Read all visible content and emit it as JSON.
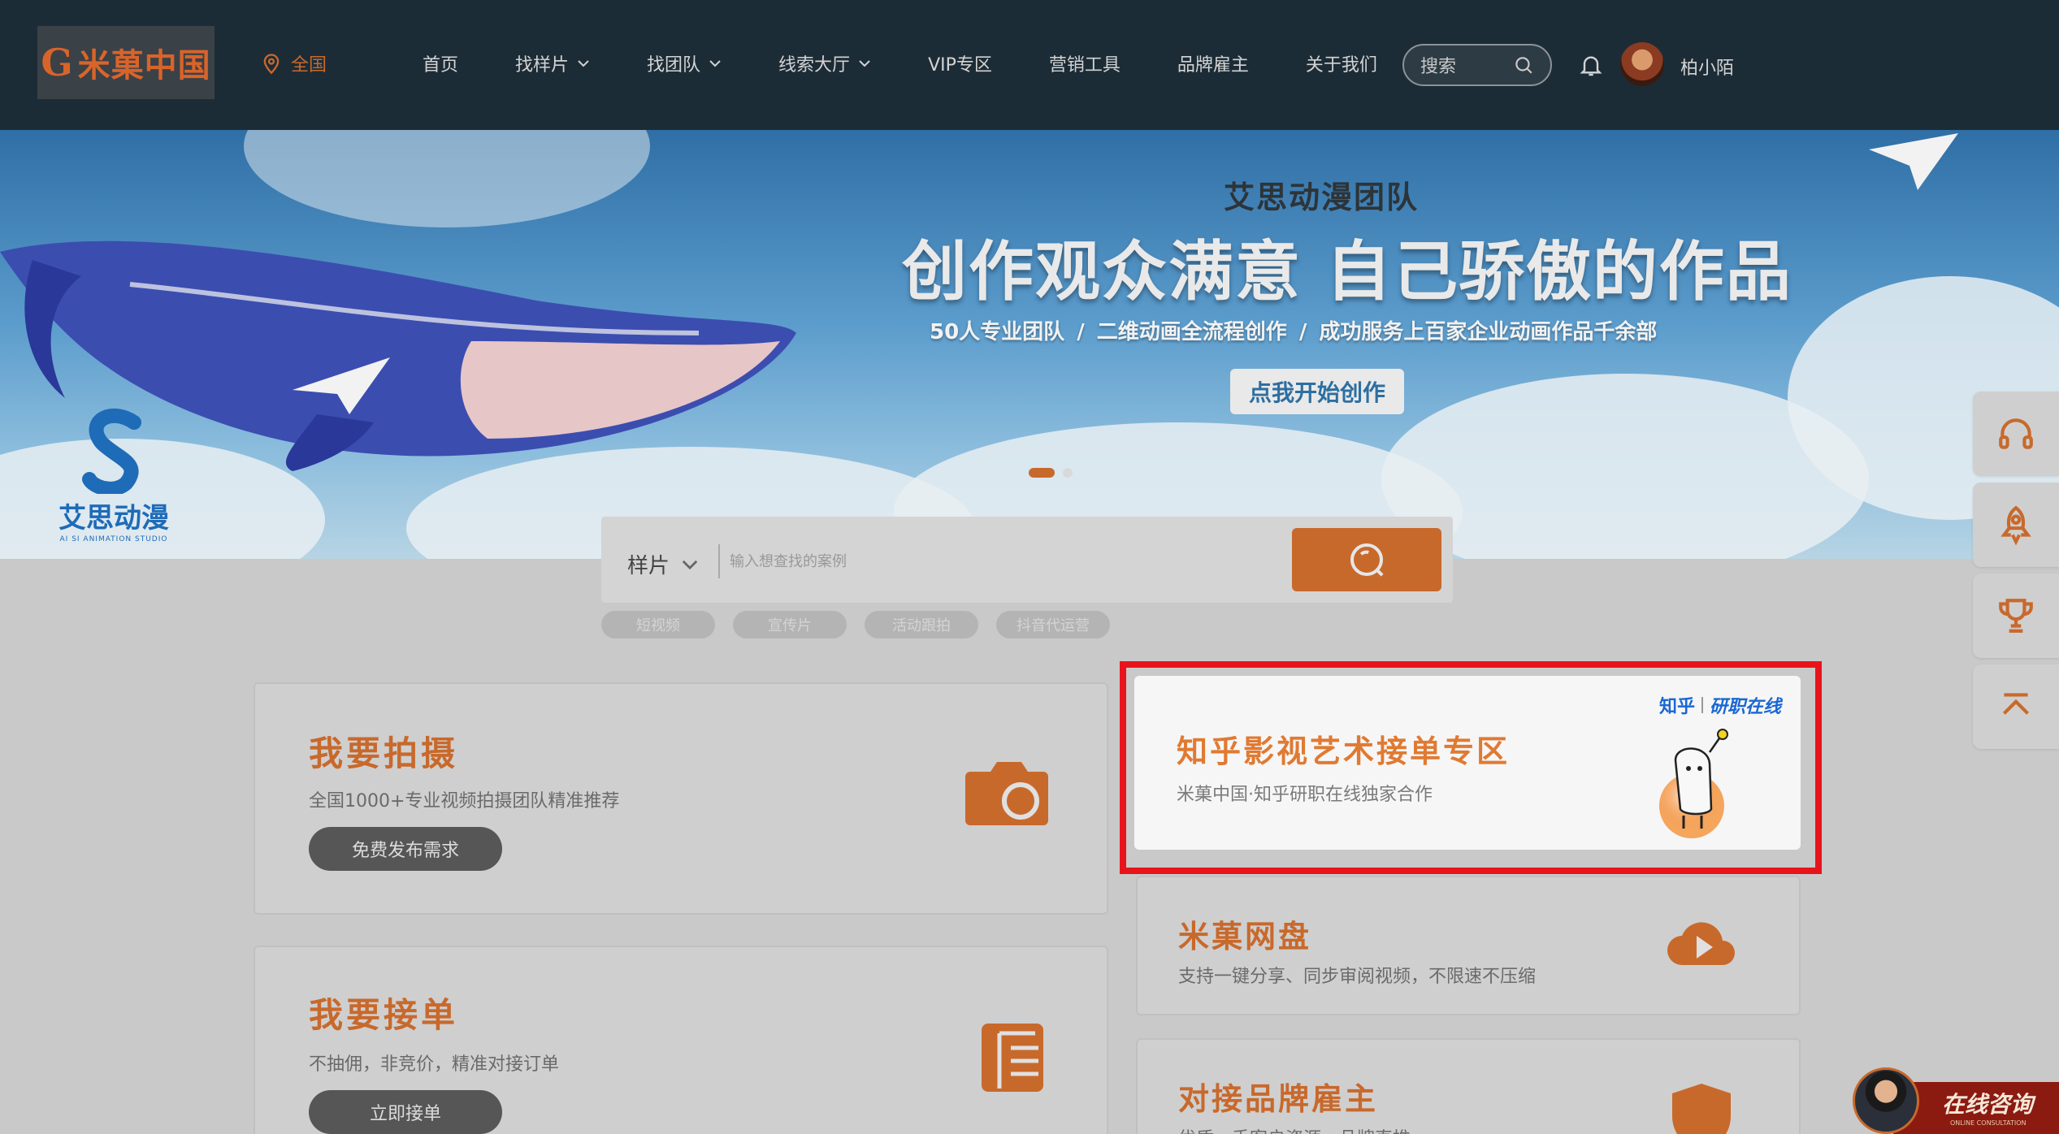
{
  "header": {
    "logo_text": "米菓中国",
    "location": "全国",
    "nav": [
      {
        "label": "首页",
        "dropdown": false
      },
      {
        "label": "找样片",
        "dropdown": true
      },
      {
        "label": "找团队",
        "dropdown": true
      },
      {
        "label": "线索大厅",
        "dropdown": true
      },
      {
        "label": "VIP专区",
        "dropdown": false
      },
      {
        "label": "营销工具",
        "dropdown": false
      },
      {
        "label": "品牌雇主",
        "dropdown": false
      },
      {
        "label": "关于我们",
        "dropdown": false
      }
    ],
    "search_label": "搜索",
    "username": "柏小陌"
  },
  "banner": {
    "subtitle": "艾思动漫团队",
    "title": "创作观众满意 自己骄傲的作品",
    "line": "50人专业团队  /  二维动画全流程创作  /  成功服务上百家企业动画作品千余部",
    "button": "点我开始创作",
    "studio_name": "艾思动漫",
    "studio_en": "AI SI ANIMATION STUDIO",
    "active_slide": 1,
    "slide_count": 2
  },
  "search": {
    "type": "样片",
    "placeholder": "输入想查找的案例",
    "tags": [
      "短视频",
      "宣传片",
      "活动跟拍",
      "抖音代运营"
    ]
  },
  "cards": {
    "shoot": {
      "title": "我要拍摄",
      "desc": "全国1000+专业视频拍摄团队精准推荐",
      "button": "免费发布需求"
    },
    "order": {
      "title": "我要接单",
      "desc": "不抽佣，非竞价，精准对接订单",
      "button": "立即接单"
    },
    "feature": {
      "brand_left": "知乎",
      "brand_right": "研职在线",
      "title": "知乎影视艺术接单专区",
      "desc": "米菓中国·知乎研职在线独家合作"
    },
    "netdisk": {
      "title": "米菓网盘",
      "desc": "支持一键分享、同步审阅视频，不限速不压缩"
    },
    "brand": {
      "title": "对接品牌雇主",
      "desc": "优质，手客户资源，品牌直推"
    }
  },
  "side_tools": [
    "headset-icon",
    "rocket-icon",
    "trophy-icon",
    "back-to-top-icon"
  ],
  "consult": {
    "label": "在线咨询",
    "sub": "ONLINE CONSULTATION"
  },
  "colors": {
    "accent": "#c8692c",
    "header_bg": "#1c2c36",
    "highlight": "#e8141c",
    "zhihu_blue": "#1967d2"
  }
}
